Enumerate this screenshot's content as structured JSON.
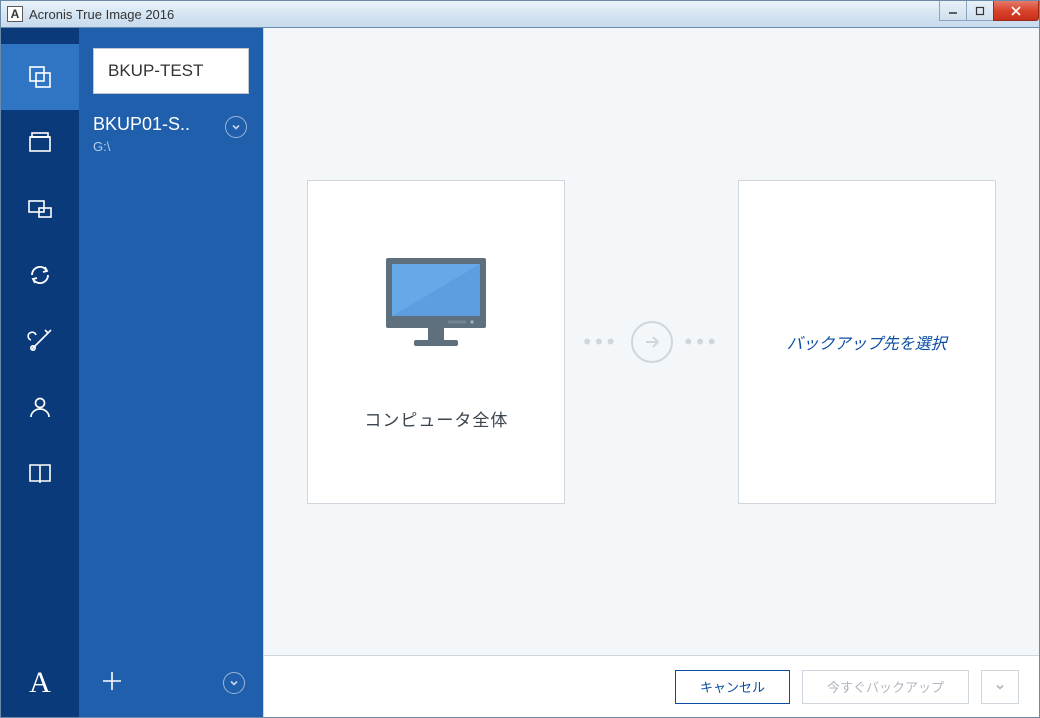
{
  "window": {
    "title": "Acronis True Image 2016",
    "icon_letter": "A"
  },
  "rail": {
    "bottom_letter": "A"
  },
  "backup_list": {
    "selected": {
      "name": "BKUP-TEST"
    },
    "items": [
      {
        "name": "BKUP01-S..",
        "sub": "G:\\"
      }
    ]
  },
  "source_card": {
    "label": "コンピュータ全体"
  },
  "dest_card": {
    "placeholder": "バックアップ先を選択"
  },
  "footer": {
    "cancel": "キャンセル",
    "backup_now": "今すぐバックアップ"
  }
}
